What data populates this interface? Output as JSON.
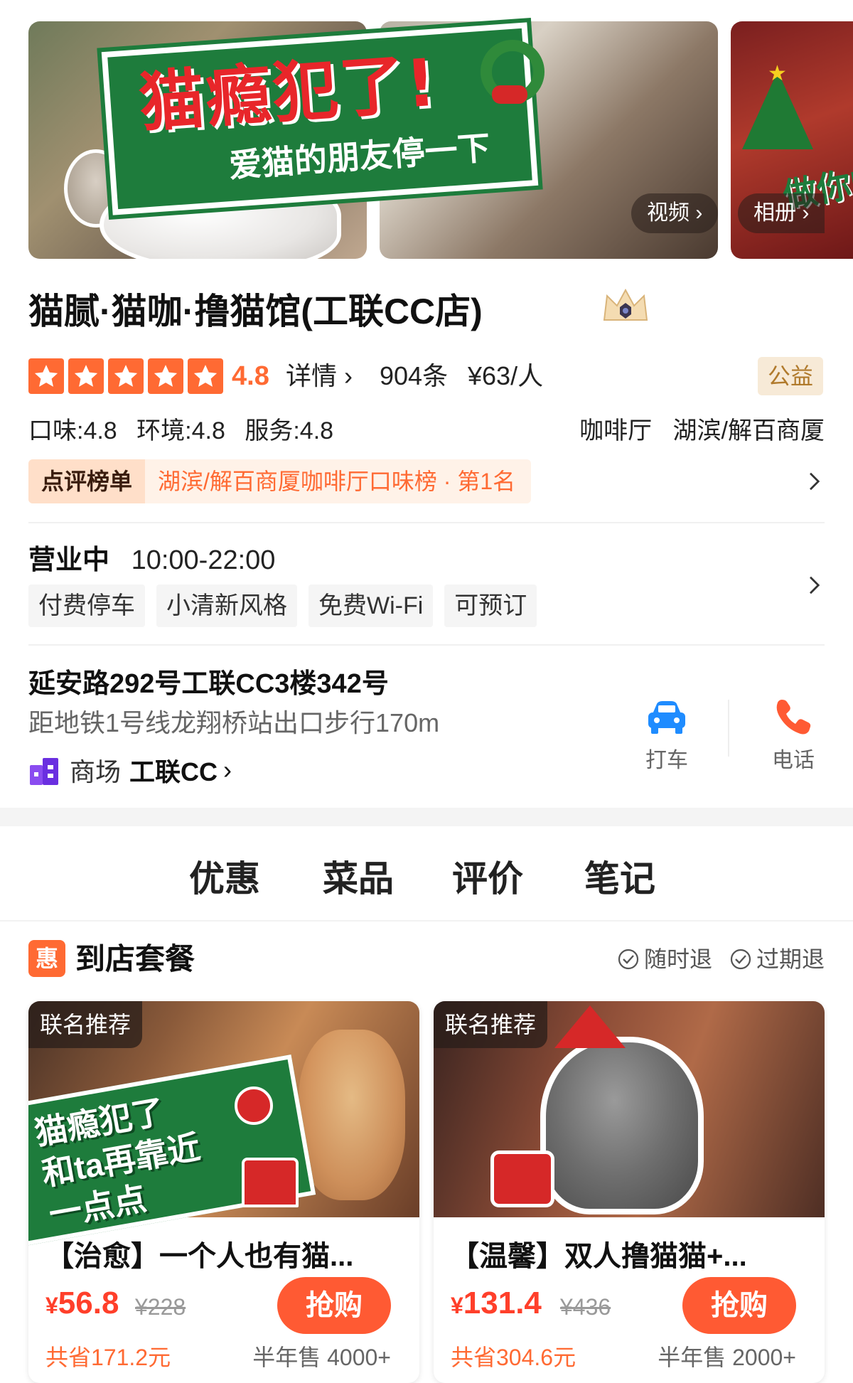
{
  "gallery": {
    "photo1_banner_title": "猫瘾犯了!",
    "photo1_banner_sub": "爱猫的朋友停一下",
    "photo3_text": "做你的猫",
    "video_label": "视频",
    "album_label": "相册"
  },
  "shop": {
    "name": "猫腻·猫咖·撸猫馆(工联CC店)",
    "rating_stars": 5,
    "score": "4.8",
    "detail_label": "详情",
    "review_count": "904条",
    "avg_price": "¥63/人",
    "charity_badge": "公益",
    "sub_scores": [
      "口味:4.8",
      "环境:4.8",
      "服务:4.8"
    ],
    "category": "咖啡厅",
    "district": "湖滨/解百商厦",
    "rank_label": "点评榜单",
    "rank_text": "湖滨/解百商厦咖啡厅口味榜 · 第1名",
    "status": "营业中",
    "hours": "10:00-22:00",
    "tags": [
      "付费停车",
      "小清新风格",
      "免费Wi-Fi",
      "可预订"
    ],
    "address": "延安路292号工联CC3楼342号",
    "subway": "距地铁1号线龙翔桥站出口步行170m",
    "mall_label": "商场",
    "mall_name": "工联CC",
    "actions": {
      "taxi": "打车",
      "phone": "电话"
    },
    "accent_color": "#ff6a33"
  },
  "tabs": [
    "优惠",
    "菜品",
    "评价",
    "笔记"
  ],
  "deals": {
    "icon_text": "惠",
    "title": "到店套餐",
    "guarantees": [
      "随时退",
      "过期退"
    ],
    "cards": [
      {
        "ribbon": "联名推荐",
        "image_text": "猫瘾犯了\n和ta再靠近\n一点点",
        "title": "【治愈】一个人也有猫...",
        "currency": "¥",
        "price": "56.8",
        "original_price": "¥228",
        "buy_label": "抢购",
        "saved": "共省171.2元",
        "sold": "半年售 4000+"
      },
      {
        "ribbon": "联名推荐",
        "title": "【温馨】双人撸猫猫+...",
        "currency": "¥",
        "price": "131.4",
        "original_price": "¥436",
        "buy_label": "抢购",
        "saved": "共省304.6元",
        "sold": "半年售 2000+"
      }
    ]
  }
}
